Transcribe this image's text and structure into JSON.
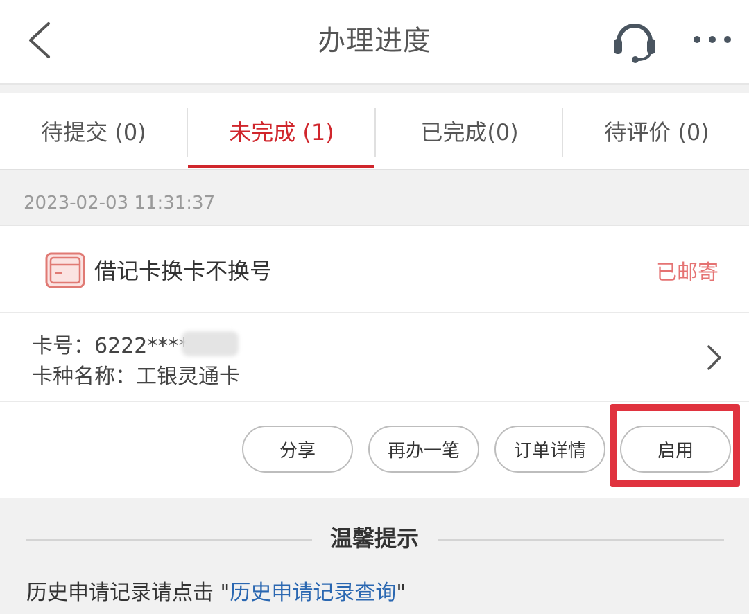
{
  "header": {
    "title": "办理进度",
    "back_icon": "chevron-left-icon",
    "service_icon": "headset-icon",
    "more_icon": "more-horizontal-icon"
  },
  "tabs": [
    {
      "label": "待提交 (0)",
      "active": false
    },
    {
      "label": "未完成 (1)",
      "active": true
    },
    {
      "label": "已完成(0)",
      "active": false
    },
    {
      "label": "待评价 (0)",
      "active": false
    }
  ],
  "record": {
    "timestamp": "2023-02-03 11:31:37",
    "service_name": "借记卡换卡不换号",
    "status": "已邮寄",
    "card_number": "卡号：6222****",
    "card_type": "卡种名称：工银灵通卡",
    "actions": {
      "share": "分享",
      "redo": "再办一笔",
      "order_detail": "订单详情",
      "activate": "启用"
    }
  },
  "tips": {
    "title": "温馨提示",
    "prefix": "历史申请记录请点击 \"",
    "link": "历史申请记录查询",
    "suffix": "\""
  },
  "colors": {
    "accent": "#d0262c",
    "status": "#e57373",
    "highlight": "#e0333f",
    "link": "#2a67b1"
  }
}
